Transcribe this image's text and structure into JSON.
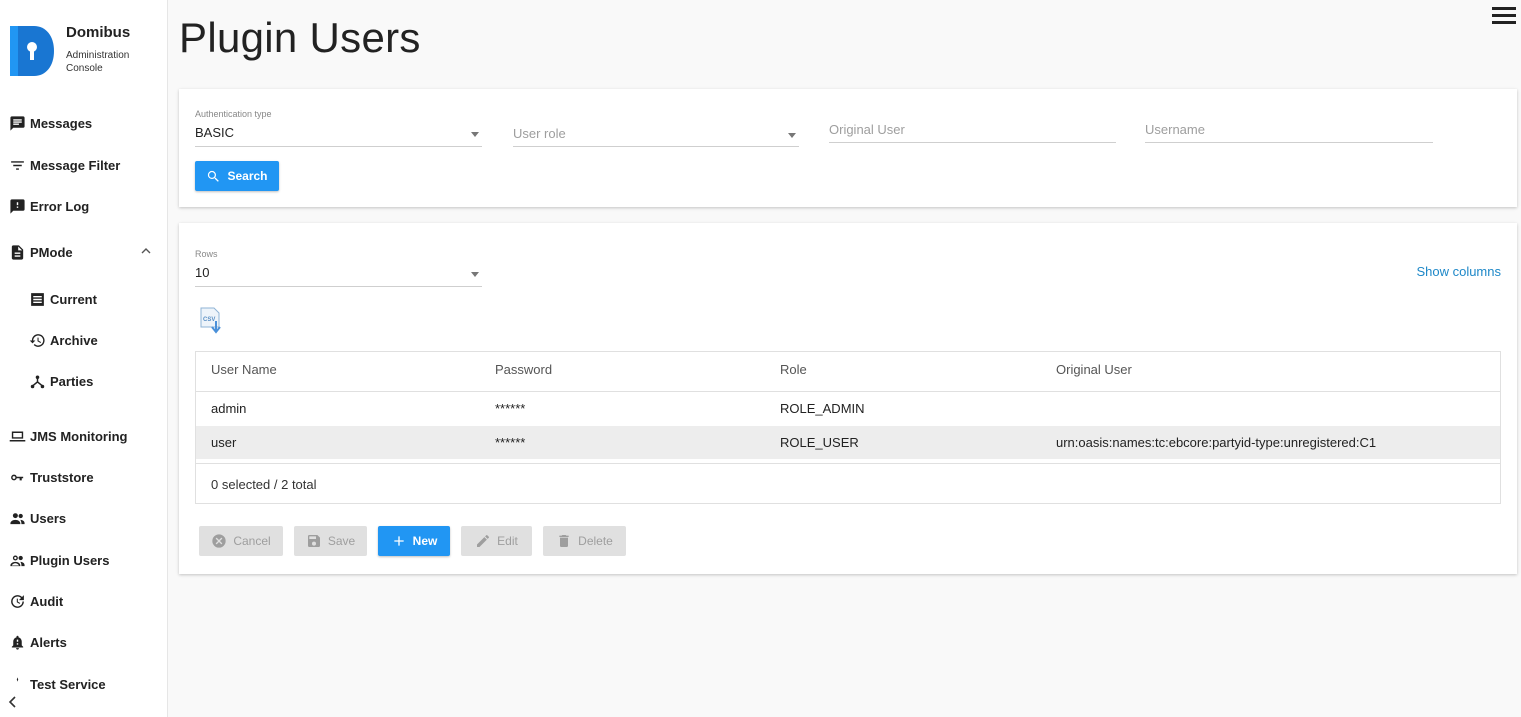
{
  "brand": {
    "title": "Domibus",
    "subtitle": "Administration Console"
  },
  "sidebar": {
    "items": [
      {
        "label": "Messages",
        "icon": "message-icon"
      },
      {
        "label": "Message Filter",
        "icon": "filter-icon"
      },
      {
        "label": "Error Log",
        "icon": "error-log-icon"
      },
      {
        "label": "PMode",
        "icon": "document-icon",
        "expanded": true,
        "children": [
          {
            "label": "Current",
            "icon": "list-icon"
          },
          {
            "label": "Archive",
            "icon": "history-icon"
          },
          {
            "label": "Parties",
            "icon": "parties-icon"
          }
        ]
      },
      {
        "label": "JMS Monitoring",
        "icon": "laptop-icon"
      },
      {
        "label": "Truststore",
        "icon": "key-icon"
      },
      {
        "label": "Users",
        "icon": "users-icon"
      },
      {
        "label": "Plugin Users",
        "icon": "plugin-users-icon"
      },
      {
        "label": "Audit",
        "icon": "audit-icon"
      },
      {
        "label": "Alerts",
        "icon": "alert-icon"
      },
      {
        "label": "Test Service",
        "icon": "test-service-icon"
      }
    ]
  },
  "page": {
    "title": "Plugin Users"
  },
  "filters": {
    "auth_type": {
      "label": "Authentication type",
      "value": "BASIC"
    },
    "user_role": {
      "placeholder": "User role"
    },
    "original_user": {
      "placeholder": "Original User"
    },
    "username": {
      "placeholder": "Username"
    },
    "search_label": "Search"
  },
  "grid": {
    "rows_label": "Rows",
    "rows_value": "10",
    "show_columns": "Show columns",
    "columns": [
      "User Name",
      "Password",
      "Role",
      "Original User"
    ],
    "rows": [
      {
        "username": "admin",
        "password": "******",
        "role": "ROLE_ADMIN",
        "original_user": ""
      },
      {
        "username": "user",
        "password": "******",
        "role": "ROLE_USER",
        "original_user": "urn:oasis:names:tc:ebcore:partyid-type:unregistered:C1"
      }
    ],
    "footer": "0 selected / 2 total"
  },
  "actions": {
    "cancel": "Cancel",
    "save": "Save",
    "new": "New",
    "edit": "Edit",
    "delete": "Delete"
  },
  "colors": {
    "primary": "#2196f3",
    "link": "#1e88c8",
    "disabled": "#e0e0e0"
  }
}
